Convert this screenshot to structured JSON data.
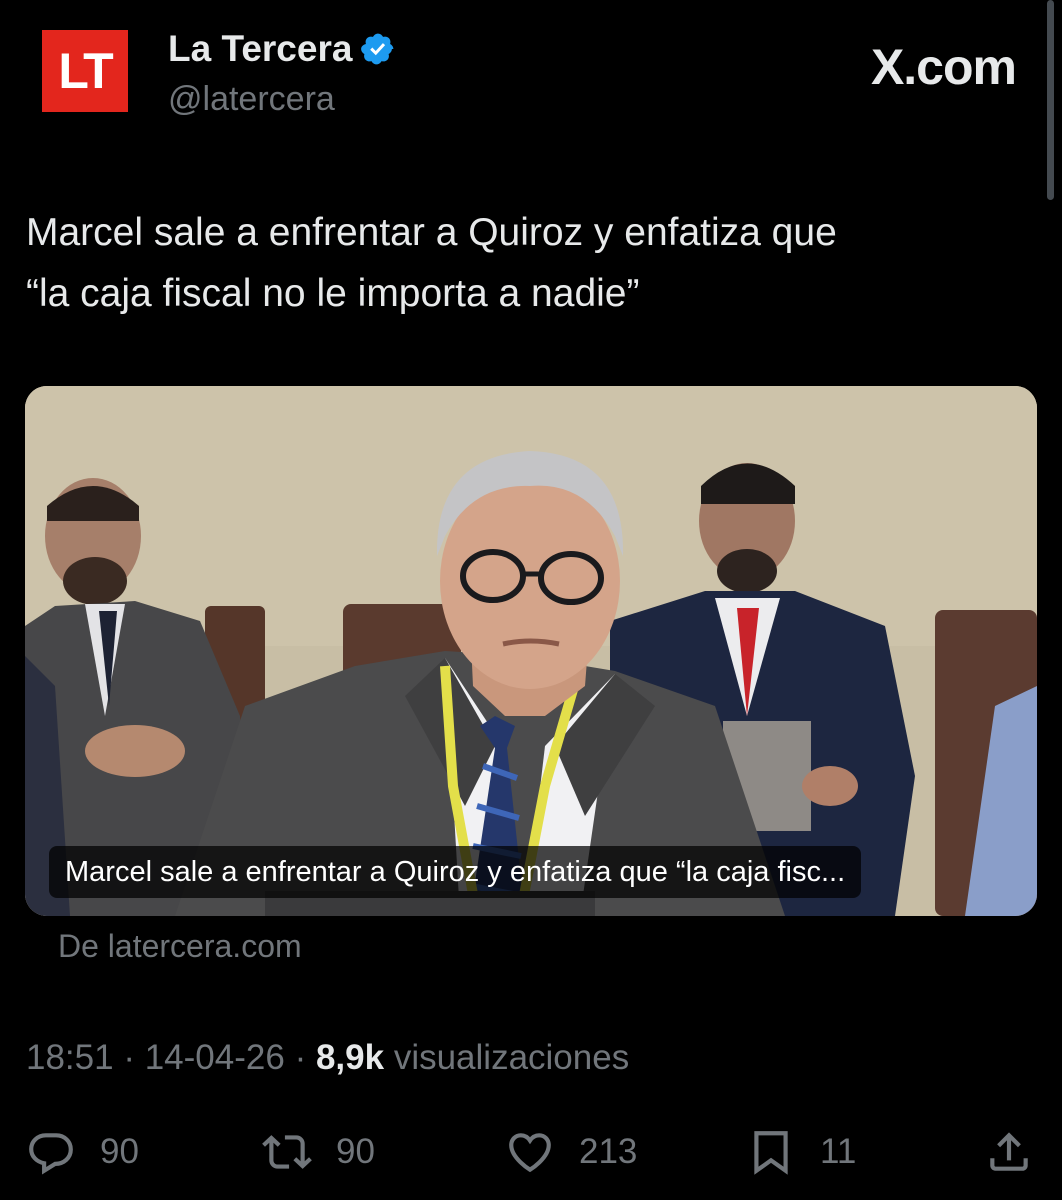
{
  "account": {
    "avatar_text": "LT",
    "display_name": "La Tercera",
    "handle": "@latercera",
    "verified_icon": "verified-badge-icon"
  },
  "source_logo": "X.com",
  "tweet": {
    "text_line1": "Marcel sale a enfrentar a Quiroz y enfatiza que",
    "text_line2": "“la caja fiscal no le importa a nadie”"
  },
  "card": {
    "caption": "Marcel sale a enfrentar a Quiroz y enfatiza que “la caja fisc...",
    "source": "De latercera.com"
  },
  "meta": {
    "time": "18:51",
    "separator": "·",
    "date": "14-04-26",
    "views_count": "8,9k",
    "views_label": "visualizaciones"
  },
  "actions": {
    "replies": "90",
    "reposts": "90",
    "likes": "213",
    "bookmarks": "11"
  },
  "colors": {
    "background": "#000000",
    "text_primary": "#e7e9ea",
    "text_secondary": "#71767b",
    "verified": "#1d9bf0",
    "brand_red": "#e3261d"
  }
}
